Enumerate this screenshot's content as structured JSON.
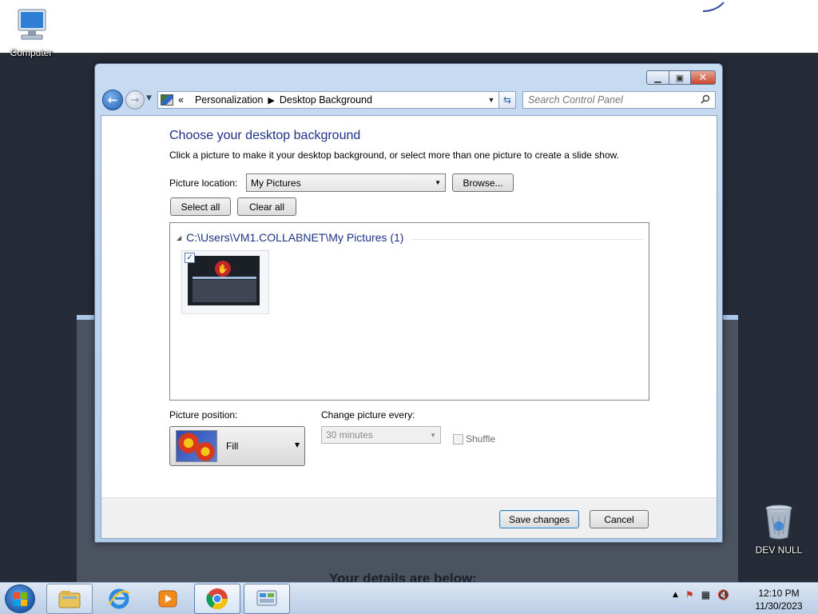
{
  "desktop": {
    "icons": [
      {
        "label": "Computer",
        "icon": "computer-icon"
      },
      {
        "label": "DEV NULL",
        "icon": "recycle-bin-icon"
      }
    ],
    "background_text": "Your details are below:"
  },
  "window": {
    "breadcrumb": {
      "overflow": "«",
      "items": [
        "Personalization",
        "Desktop Background"
      ]
    },
    "search": {
      "placeholder": "Search Control Panel"
    },
    "title": "Choose your desktop background",
    "subtitle": "Click a picture to make it your desktop background, or select more than one picture to create a slide show.",
    "picture_location": {
      "label": "Picture location:",
      "value": "My Pictures"
    },
    "browse_label": "Browse...",
    "select_all_label": "Select all",
    "clear_all_label": "Clear all",
    "gallery": {
      "group_label": "C:\\Users\\VM1.COLLABNET\\My Pictures (1)",
      "items": [
        {
          "checked": true
        }
      ]
    },
    "picture_position": {
      "label": "Picture position:",
      "value": "Fill"
    },
    "change_every": {
      "label": "Change picture every:",
      "value": "30 minutes"
    },
    "shuffle": {
      "label": "Shuffle",
      "checked": false
    },
    "save_label": "Save changes",
    "cancel_label": "Cancel"
  },
  "taskbar": {
    "pinned": [
      "windows-explorer-icon",
      "internet-explorer-icon",
      "media-player-icon",
      "chrome-icon",
      "control-panel-icon"
    ],
    "clock": {
      "time": "12:10 PM",
      "date": "11/30/2023"
    }
  },
  "colors": {
    "heading": "#1e3287",
    "window_frame": "#b2cbe8",
    "close_button": "#c8462e"
  }
}
